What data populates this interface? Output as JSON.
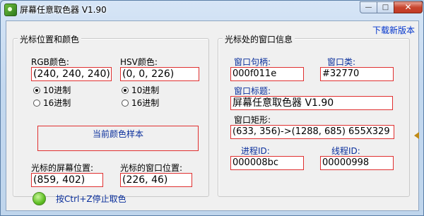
{
  "window": {
    "title": "屏幕任意取色器 V1.90",
    "min_symbol": "—",
    "max_symbol": "□",
    "close_symbol": "✕"
  },
  "download_link": "下载新版本",
  "cursor_group": {
    "title": "光标位置和颜色",
    "rgb_label": "RGB颜色:",
    "rgb_value": "(240, 240, 240)",
    "rgb_radio_decimal": "10进制",
    "rgb_radio_hex": "16进制",
    "hsv_label": "HSV颜色:",
    "hsv_value": "(0, 0, 226)",
    "hsv_radio_decimal": "10进制",
    "hsv_radio_hex": "16进制",
    "sample_label": "当前颜色样本",
    "screen_pos_label": "光标的屏幕位置:",
    "screen_pos_value": "(859, 402)",
    "window_pos_label": "光标的窗口位置:",
    "window_pos_value": "(226, 46)"
  },
  "window_group": {
    "title": "光标处的窗口信息",
    "handle_label": "窗口句柄:",
    "handle_value": "000f011e",
    "class_label": "窗口类:",
    "class_value": "#32770",
    "title_label": "窗口标题:",
    "title_value": "屏幕任意取色器 V1.90",
    "rect_label": "窗口矩形:",
    "rect_value": "(633, 356)->(1288, 685) 655X329",
    "process_label": "进程ID:",
    "process_value": "000008bc",
    "thread_label": "线程ID:",
    "thread_value": "00000998"
  },
  "hint": "按Ctrl+Z停止取色",
  "colors": {
    "field_border": "#e03030",
    "label_blue": "#0a2f9c",
    "status_green": "#5fbf24"
  }
}
